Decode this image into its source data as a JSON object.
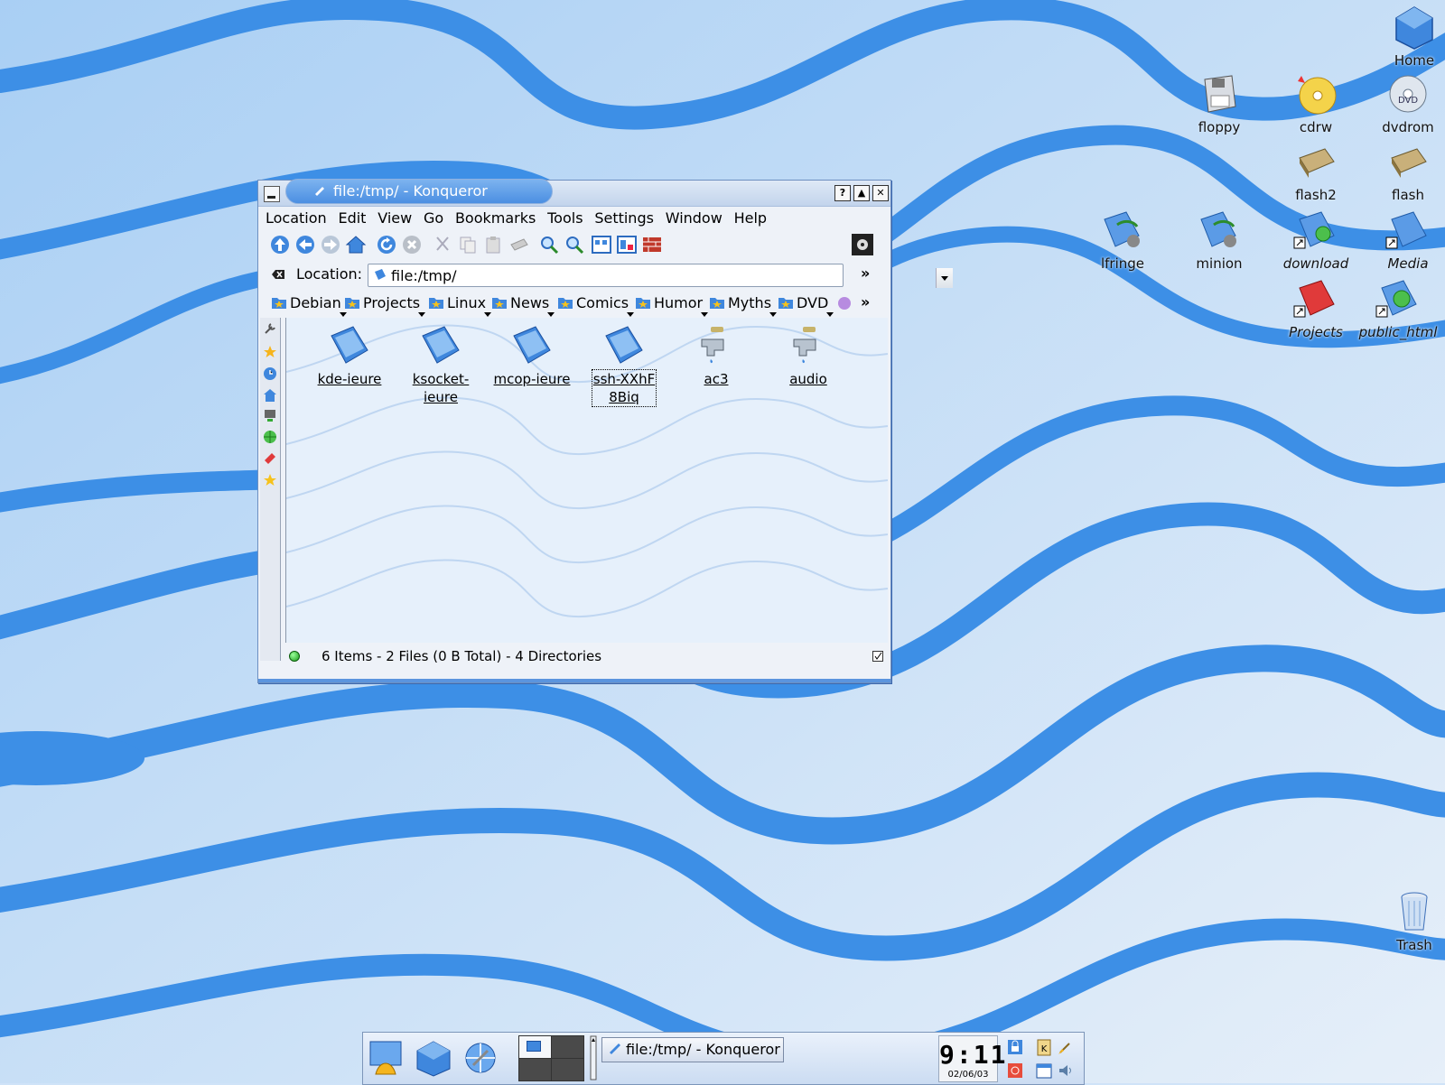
{
  "window": {
    "title": "file:/tmp/ - Konqueror",
    "menu": [
      {
        "label": "Location"
      },
      {
        "label": "Edit"
      },
      {
        "label": "View"
      },
      {
        "label": "Go"
      },
      {
        "label": "Bookmarks"
      },
      {
        "label": "Tools"
      },
      {
        "label": "Settings"
      },
      {
        "label": "Window"
      },
      {
        "label": "Help"
      }
    ],
    "location_label": "Location:",
    "location_value": "file:/tmp/",
    "bookmarks": [
      "Debian",
      "Projects",
      "Linux",
      "News",
      "Comics",
      "Humor",
      "Myths",
      "DVD"
    ],
    "files": [
      {
        "name": "kde-ieure",
        "type": "folder"
      },
      {
        "name": "ksocket-ieure",
        "type": "folder"
      },
      {
        "name": "mcop-ieure",
        "type": "folder"
      },
      {
        "name": "ssh-XXhF8Biq",
        "type": "folder",
        "selected": true
      },
      {
        "name": "ac3",
        "type": "pipe"
      },
      {
        "name": "audio",
        "type": "pipe"
      }
    ],
    "status": "6 Items - 2 Files (0 B Total) - 4 Directories"
  },
  "desktop": {
    "icons": [
      {
        "label": "Home",
        "icon": "home-icon"
      },
      {
        "label": "floppy",
        "icon": "floppy-icon"
      },
      {
        "label": "cdrw",
        "icon": "cdrw-icon"
      },
      {
        "label": "dvdrom",
        "icon": "dvdrom-icon"
      },
      {
        "label": "flash2",
        "icon": "flash-drive-icon"
      },
      {
        "label": "flash",
        "icon": "flash-drive-icon"
      },
      {
        "label": "lfringe",
        "icon": "network-folder-icon"
      },
      {
        "label": "minion",
        "icon": "network-folder-icon"
      },
      {
        "label": "download",
        "icon": "folder-link-icon"
      },
      {
        "label": "Media",
        "icon": "folder-link-icon"
      },
      {
        "label": "Projects",
        "icon": "red-folder-link-icon"
      },
      {
        "label": "public_html",
        "icon": "web-folder-link-icon"
      },
      {
        "label": "Trash",
        "icon": "trash-icon"
      }
    ]
  },
  "panel": {
    "task_title": "file:/tmp/ - Konqueror",
    "clock_time": "9:11",
    "clock_date": "02/06/03"
  },
  "colors": {
    "wallpaper_light": "#d7e8f8",
    "wallpaper_wave": "#3d8fe6",
    "title_accent": "#4b8fe2",
    "folder_blue": "#3f87dd"
  }
}
